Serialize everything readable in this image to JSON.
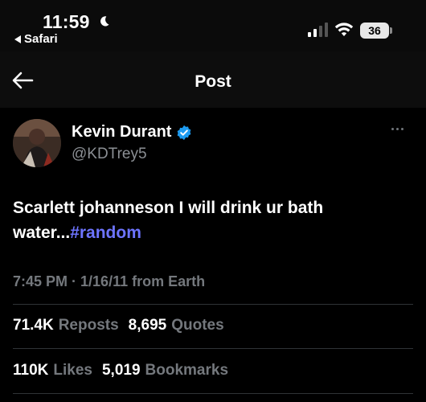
{
  "status_bar": {
    "time": "11:59",
    "back_app": "Safari",
    "battery": "36"
  },
  "header": {
    "title": "Post"
  },
  "post": {
    "author_name": "Kevin Durant",
    "handle": "@KDTrey5",
    "text_main": "Scarlett johanneson I will drink ur bath water...",
    "hashtag": "#random",
    "time": "7:45 PM",
    "separator": " · ",
    "date": "1/16/11",
    "source": " from Earth"
  },
  "stats": {
    "reposts_count": "71.4K",
    "reposts_label": "Reposts",
    "quotes_count": "8,695",
    "quotes_label": "Quotes",
    "likes_count": "110K",
    "likes_label": "Likes",
    "bookmarks_count": "5,019",
    "bookmarks_label": "Bookmarks"
  },
  "colors": {
    "background": "#000000",
    "hashtag": "#6d74ff",
    "verified": "#1d9bf0",
    "muted": "#74787d"
  }
}
